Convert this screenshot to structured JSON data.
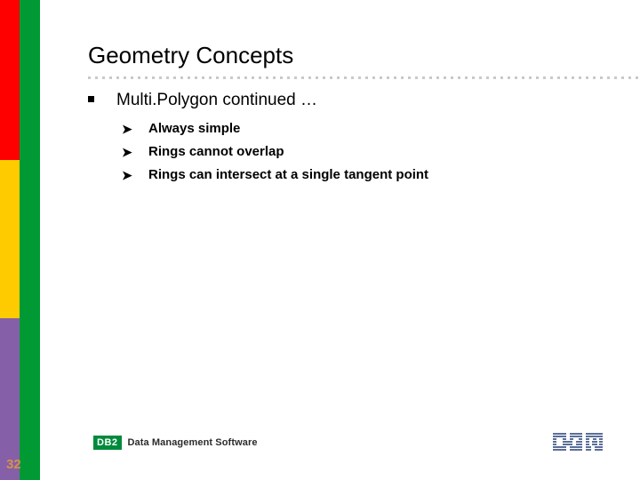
{
  "slide": {
    "title": "Geometry Concepts",
    "page_number": "32",
    "accent_colors": {
      "red": "#fe0000",
      "yellow": "#fecb00",
      "purple": "#8560a8",
      "green": "#009933",
      "db2_green": "#008a3c",
      "ibm_blue": "#5a6e98",
      "page_number_color": "#d6914a",
      "rule_gray": "#c9c9c9"
    },
    "bullets": [
      {
        "marker": "square-bullet",
        "text": "Multi.Polygon continued …",
        "children": [
          {
            "marker": "arrow-bullet",
            "text": "Always simple"
          },
          {
            "marker": "arrow-bullet",
            "text": "Rings cannot overlap"
          },
          {
            "marker": "arrow-bullet",
            "text": "Rings can intersect at a single tangent point"
          }
        ]
      }
    ]
  },
  "footer": {
    "badge_label": "DB2",
    "product_line": "Data Management Software",
    "brand_logo": "ibm-logo"
  }
}
